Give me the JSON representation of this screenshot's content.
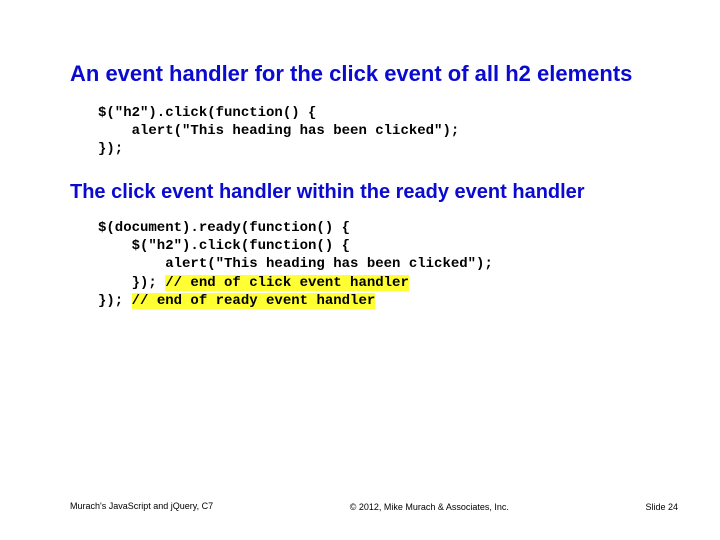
{
  "heading1": "An event handler for the click event of all h2 elements",
  "code1": {
    "line1": "$(\"h2\").click(function() {",
    "line2": "    alert(\"This heading has been clicked\");",
    "line3": "});"
  },
  "heading2": "The click event handler within the ready event handler",
  "code2": {
    "line1": "$(document).ready(function() {",
    "line2": "    $(\"h2\").click(function() {",
    "line3": "        alert(\"This heading has been clicked\");",
    "line4_pre": "    }); ",
    "line4_hl": "// end of click event handler",
    "line5_pre": "}); ",
    "line5_hl": "// end of ready event handler"
  },
  "footer": {
    "left": "Murach's JavaScript and jQuery, C7",
    "center": "© 2012, Mike Murach & Associates, Inc.",
    "right": "Slide 24"
  }
}
